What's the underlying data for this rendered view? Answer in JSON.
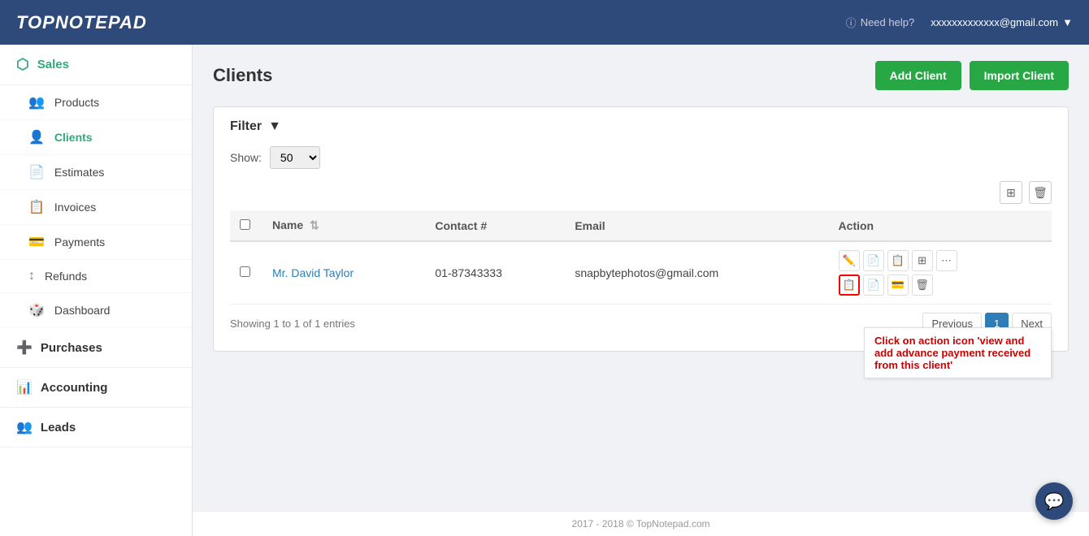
{
  "header": {
    "logo": "TopNotepad",
    "help_label": "Need help?",
    "user_email": "xxxxxxxxxxxxx@gmail.com",
    "email_arrow": "▼"
  },
  "sidebar": {
    "sales_label": "Sales",
    "items": [
      {
        "id": "products",
        "label": "Products",
        "icon": "👥"
      },
      {
        "id": "clients",
        "label": "Clients",
        "icon": "👤",
        "active": true
      },
      {
        "id": "estimates",
        "label": "Estimates",
        "icon": "📄"
      },
      {
        "id": "invoices",
        "label": "Invoices",
        "icon": "📋"
      },
      {
        "id": "payments",
        "label": "Payments",
        "icon": "💳"
      },
      {
        "id": "refunds",
        "label": "Refunds",
        "icon": "↕"
      },
      {
        "id": "dashboard",
        "label": "Dashboard",
        "icon": "🎲"
      }
    ],
    "groups": [
      {
        "id": "purchases",
        "label": "Purchases",
        "icon": "➕"
      },
      {
        "id": "accounting",
        "label": "Accounting",
        "icon": "📊"
      },
      {
        "id": "leads",
        "label": "Leads",
        "icon": "👥"
      }
    ]
  },
  "page": {
    "title": "Clients",
    "add_client_label": "Add Client",
    "import_client_label": "Import Client"
  },
  "filter": {
    "label": "Filter",
    "show_label": "Show:",
    "show_value": "50"
  },
  "table": {
    "columns": [
      "",
      "Name",
      "",
      "Contact #",
      "Email",
      "Action"
    ],
    "rows": [
      {
        "name": "Mr. David Taylor",
        "contact": "01-87343333",
        "email": "snapbytephotos@gmail.com"
      }
    ],
    "showing_text": "Showing 1 to 1 of 1 entries"
  },
  "pagination": {
    "prev_label": "Previous",
    "next_label": "Next",
    "current_page": "1"
  },
  "tooltip": {
    "text": "Click on action icon 'view and add advance payment received from this client'"
  },
  "footer": {
    "text": "2017 - 2018 © TopNotepad.com"
  }
}
